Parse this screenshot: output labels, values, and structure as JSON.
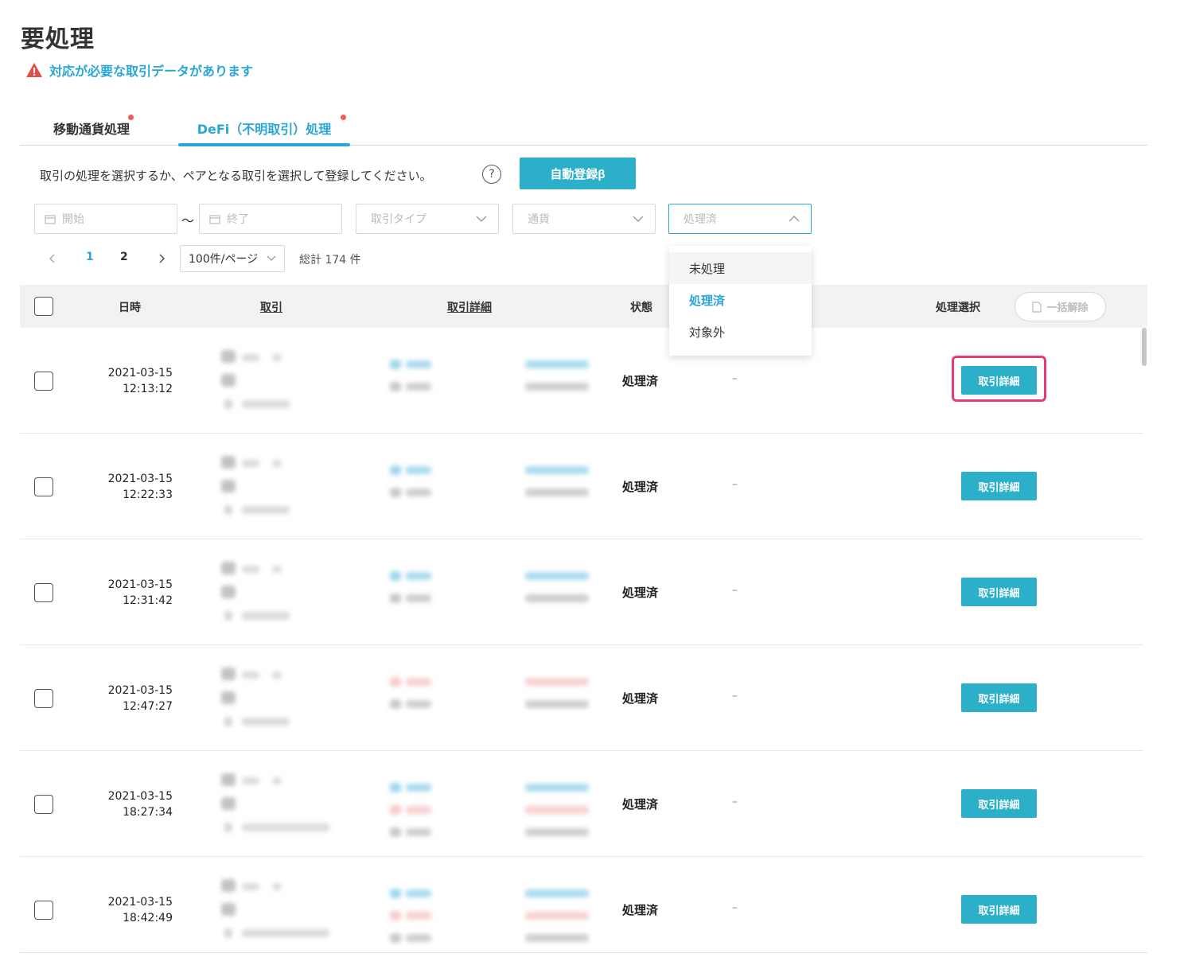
{
  "page": {
    "title": "要処理",
    "alert": "対応が必要な取引データがあります"
  },
  "tabs": [
    {
      "label": "移動通貨処理",
      "active": false
    },
    {
      "label": "DeFi（不明取引）処理",
      "active": true
    }
  ],
  "toolbar": {
    "instruction": "取引の処理を選択するか、ペアとなる取引を選択して登録してください。",
    "help": "?",
    "auto_register": "自動登録β"
  },
  "filters": {
    "start_placeholder": "開始",
    "range_sep": "〜",
    "end_placeholder": "終了",
    "type_placeholder": "取引タイプ",
    "currency_placeholder": "通貨",
    "status_value": "処理済"
  },
  "status_dropdown": {
    "options": [
      "未処理",
      "処理済",
      "対象外"
    ],
    "selected": "処理済"
  },
  "pagination": {
    "prev": "<",
    "pages": [
      "1",
      "2"
    ],
    "current": "1",
    "next": ">",
    "per_page": "100件/ページ",
    "total": "総計 174 件"
  },
  "table": {
    "headers": {
      "datetime": "日時",
      "transaction": "取引",
      "detail": "取引詳細",
      "state": "状態",
      "action": "処理選択",
      "bulk_release": "一括解除"
    },
    "detail_button": "取引詳細",
    "rows": [
      {
        "date": "2021-03-15",
        "time": "12:13:12",
        "state": "処理済",
        "note": "–",
        "highlighted": true
      },
      {
        "date": "2021-03-15",
        "time": "12:22:33",
        "state": "処理済",
        "note": "–",
        "highlighted": false
      },
      {
        "date": "2021-03-15",
        "time": "12:31:42",
        "state": "処理済",
        "note": "–",
        "highlighted": false
      },
      {
        "date": "2021-03-15",
        "time": "12:47:27",
        "state": "処理済",
        "note": "–",
        "highlighted": false
      },
      {
        "date": "2021-03-15",
        "time": "18:27:34",
        "state": "処理済",
        "note": "–",
        "highlighted": false
      },
      {
        "date": "2021-03-15",
        "time": "18:42:49",
        "state": "処理済",
        "note": "–",
        "highlighted": false
      }
    ]
  },
  "colors": {
    "accent": "#2aa6d6",
    "button": "#2cb0c9",
    "highlight": "#e83a6f",
    "badge_dot": "#ef5a5a"
  }
}
